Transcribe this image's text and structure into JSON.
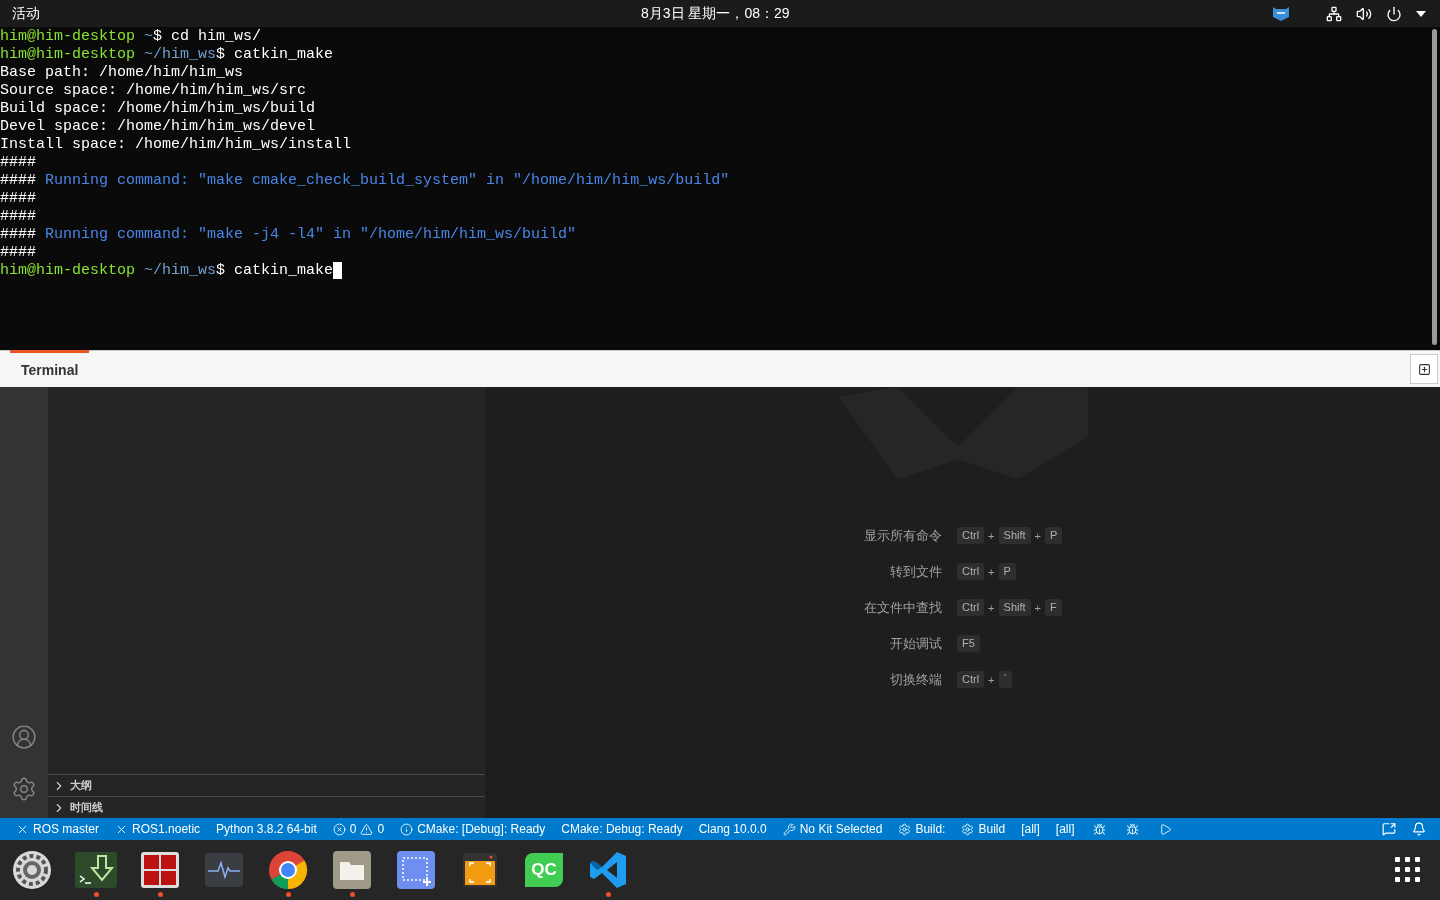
{
  "top_bar": {
    "activities": "活动",
    "clock": "8月3日 星期一，08：29"
  },
  "terminal": {
    "lines": [
      {
        "kind": "prompt",
        "host": "him@him-desktop",
        "path": "~",
        "symbol": "$",
        "command": "cd him_ws/",
        "cursor": false
      },
      {
        "kind": "prompt",
        "host": "him@him-desktop",
        "path": "~/him_ws",
        "symbol": "$",
        "command": "catkin_make",
        "cursor": false
      },
      {
        "kind": "plain",
        "text": "Base path: /home/him/him_ws"
      },
      {
        "kind": "plain",
        "text": "Source space: /home/him/him_ws/src"
      },
      {
        "kind": "plain",
        "text": "Build space: /home/him/him_ws/build"
      },
      {
        "kind": "plain",
        "text": "Devel space: /home/him/him_ws/devel"
      },
      {
        "kind": "plain",
        "text": "Install space: /home/him/him_ws/install"
      },
      {
        "kind": "plain",
        "text": "####"
      },
      {
        "kind": "info",
        "prefix": "####",
        "text": "Running command: \"make cmake_check_build_system\" in \"/home/him/him_ws/build\""
      },
      {
        "kind": "plain",
        "text": "####"
      },
      {
        "kind": "plain",
        "text": "####"
      },
      {
        "kind": "info",
        "prefix": "####",
        "text": "Running command: \"make -j4 -l4\" in \"/home/him/him_ws/build\""
      },
      {
        "kind": "plain",
        "text": "####"
      },
      {
        "kind": "prompt",
        "host": "him@him-desktop",
        "path": "~/him_ws",
        "symbol": "$",
        "command": "catkin_make",
        "cursor": true
      }
    ],
    "tabs": [
      {
        "label": "Terminal",
        "selected": true
      }
    ]
  },
  "sidebar": {
    "sections": [
      {
        "label": "大纲",
        "expanded": false
      },
      {
        "label": "时间线",
        "expanded": false
      }
    ]
  },
  "welcome": {
    "key_joiner": "+",
    "shortcuts": [
      {
        "label": "显示所有命令",
        "keys": [
          "Ctrl",
          "Shift",
          "P"
        ]
      },
      {
        "label": "转到文件",
        "keys": [
          "Ctrl",
          "P"
        ]
      },
      {
        "label": "在文件中查找",
        "keys": [
          "Ctrl",
          "Shift",
          "F"
        ]
      },
      {
        "label": "开始调试",
        "keys": [
          "F5"
        ]
      },
      {
        "label": "切换终端",
        "keys": [
          "Ctrl",
          "`"
        ]
      }
    ]
  },
  "status_bar": {
    "items": [
      {
        "kind": "close",
        "text": "ROS master"
      },
      {
        "kind": "close",
        "text": "ROS1.noetic"
      },
      {
        "kind": "text",
        "text": "Python 3.8.2 64-bit"
      },
      {
        "kind": "problems",
        "errors": "0",
        "warnings": "0"
      },
      {
        "kind": "info",
        "text": "CMake: [Debug]: Ready"
      },
      {
        "kind": "text",
        "text": "CMake: Debug: Ready"
      },
      {
        "kind": "text",
        "text": "Clang 10.0.0"
      },
      {
        "kind": "tools",
        "text": "No Kit Selected"
      },
      {
        "kind": "gear",
        "text": "Build:"
      },
      {
        "kind": "gear",
        "text": "Build"
      },
      {
        "kind": "text",
        "text": "[all]"
      },
      {
        "kind": "text",
        "text": "[all]"
      },
      {
        "kind": "bug"
      },
      {
        "kind": "bug"
      },
      {
        "kind": "play"
      }
    ]
  },
  "dock": {
    "apps": [
      {
        "kind": "settings",
        "running": false
      },
      {
        "kind": "terminal-download",
        "running": true
      },
      {
        "kind": "terminator",
        "running": true
      },
      {
        "kind": "monitor",
        "running": false
      },
      {
        "kind": "chrome",
        "running": true
      },
      {
        "kind": "files",
        "running": true
      },
      {
        "kind": "screenshot",
        "running": false
      },
      {
        "kind": "frame",
        "running": false
      },
      {
        "kind": "qt",
        "label": "QC",
        "running": false
      },
      {
        "kind": "vscode",
        "running": true
      }
    ]
  }
}
